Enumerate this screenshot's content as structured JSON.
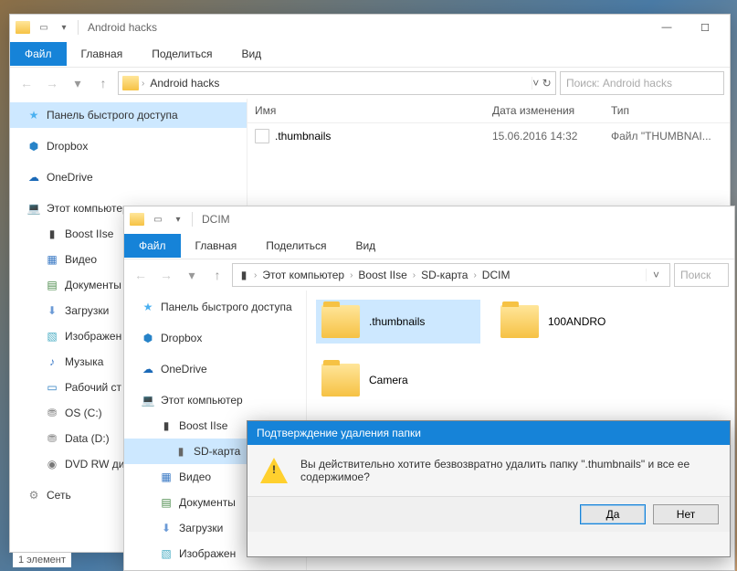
{
  "win1": {
    "title": "Android hacks",
    "tabs": {
      "file": "Файл",
      "home": "Главная",
      "share": "Поделиться",
      "view": "Вид"
    },
    "address": {
      "segs": [
        "Android hacks"
      ]
    },
    "search_placeholder": "Поиск: Android hacks",
    "columns": {
      "name": "Имя",
      "date": "Дата изменения",
      "type": "Тип"
    },
    "row": {
      "name": ".thumbnails",
      "date": "15.06.2016 14:32",
      "type": "Файл \"THUMBNAI..."
    },
    "sidebar": {
      "quick": "Панель быстрого доступа",
      "dropbox": "Dropbox",
      "onedrive": "OneDrive",
      "pc": "Этот компьютер",
      "boost": "Boost IIse",
      "video": "Видео",
      "docs": "Документы",
      "dl": "Загрузки",
      "img": "Изображен",
      "mus": "Музыка",
      "desk": "Рабочий ст",
      "osc": "OS (C:)",
      "datad": "Data (D:)",
      "dvd": "DVD RW ди",
      "net": "Сеть"
    },
    "status": "1 элемент"
  },
  "win2": {
    "title": "DCIM",
    "tabs": {
      "file": "Файл",
      "home": "Главная",
      "share": "Поделиться",
      "view": "Вид"
    },
    "address": {
      "segs": [
        "Этот компьютер",
        "Boost IIse",
        "SD-карта",
        "DCIM"
      ]
    },
    "search_placeholder": "Поиск",
    "sidebar": {
      "quick": "Панель быстрого доступа",
      "dropbox": "Dropbox",
      "onedrive": "OneDrive",
      "pc": "Этот компьютер",
      "boost": "Boost IIse",
      "sd": "SD-карта",
      "video": "Видео",
      "docs": "Документы",
      "dl": "Загрузки",
      "img": "Изображен"
    },
    "folders": {
      "thumb": ".thumbnails",
      "andro": "100ANDRO",
      "cam": "Camera"
    }
  },
  "dialog": {
    "title": "Подтверждение удаления папки",
    "msg": "Вы действительно хотите безвозвратно удалить папку \".thumbnails\" и все ее содержимое?",
    "yes": "Да",
    "no": "Нет"
  }
}
